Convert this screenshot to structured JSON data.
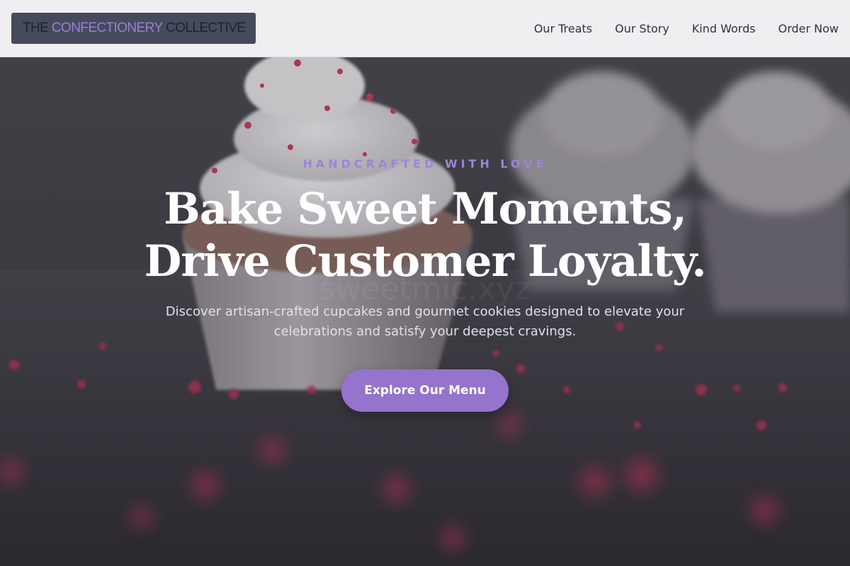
{
  "header": {
    "logo": {
      "part1": "THE ",
      "part2": "CONFECTIONERY",
      "part3": " COLLECTIVE"
    },
    "nav": [
      {
        "label": "Our Treats"
      },
      {
        "label": "Our Story"
      },
      {
        "label": "Kind Words"
      },
      {
        "label": "Order Now"
      }
    ]
  },
  "hero": {
    "tagline": "HANDCRAFTED WITH LOVE",
    "headline_line1": "Bake Sweet Moments,",
    "headline_line2": "Drive Customer Loyalty.",
    "subtitle": "Discover artisan-crafted cupcakes and gourmet cookies designed to elevate your celebrations and satisfy your deepest cravings.",
    "cta_label": "Explore Our Menu",
    "watermark": "sweetmic.xyz"
  },
  "colors": {
    "accent": "#9474cc",
    "tagline": "#9d85d8",
    "header_bg": "#efeff1",
    "logo_bg": "#454b5c",
    "hero_bg": "#3f3c44"
  }
}
